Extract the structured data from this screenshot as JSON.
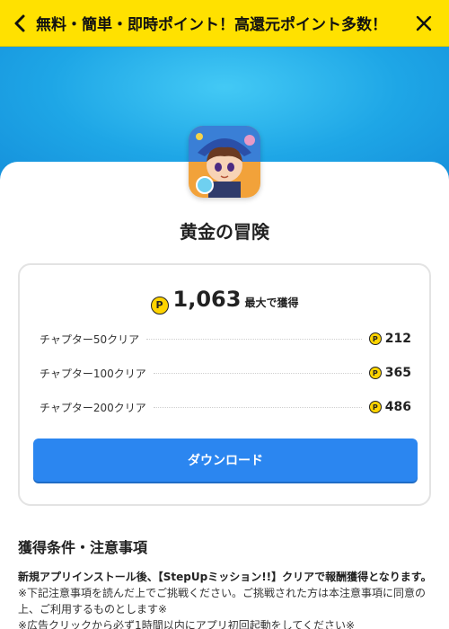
{
  "header": {
    "title": "無料・簡単・即時ポイント！高還元ポイント多数！",
    "back_icon": "chevron-left-icon",
    "close_icon": "close-icon"
  },
  "colors": {
    "header_bg": "#ffe100",
    "hero_bg": "#1ea6e6",
    "button_bg": "#2b86f0",
    "coin": "#ffd400"
  },
  "app": {
    "title": "黄金の冒険",
    "icon": "app-icon-game-character"
  },
  "reward": {
    "coin_symbol": "P",
    "total": "1,063",
    "total_suffix": "最大で獲得",
    "items": [
      {
        "label": "チャプター50クリア",
        "points": "212"
      },
      {
        "label": "チャプター100クリア",
        "points": "365"
      },
      {
        "label": "チャプター200クリア",
        "points": "486"
      }
    ],
    "download_label": "ダウンロード"
  },
  "conditions": {
    "title": "獲得条件・注意事項",
    "headline": "新規アプリインストール後、【StepUpミッション!!】クリアで報酬獲得となります。",
    "lines": [
      "※下記注意事項を読んだ上でご挑戦ください。ご挑戦された方は本注意事項に同意の上、ご利用するものとします※",
      "※広告クリックから必ず1時間以内にアプリ初回起動をしてください※"
    ]
  }
}
